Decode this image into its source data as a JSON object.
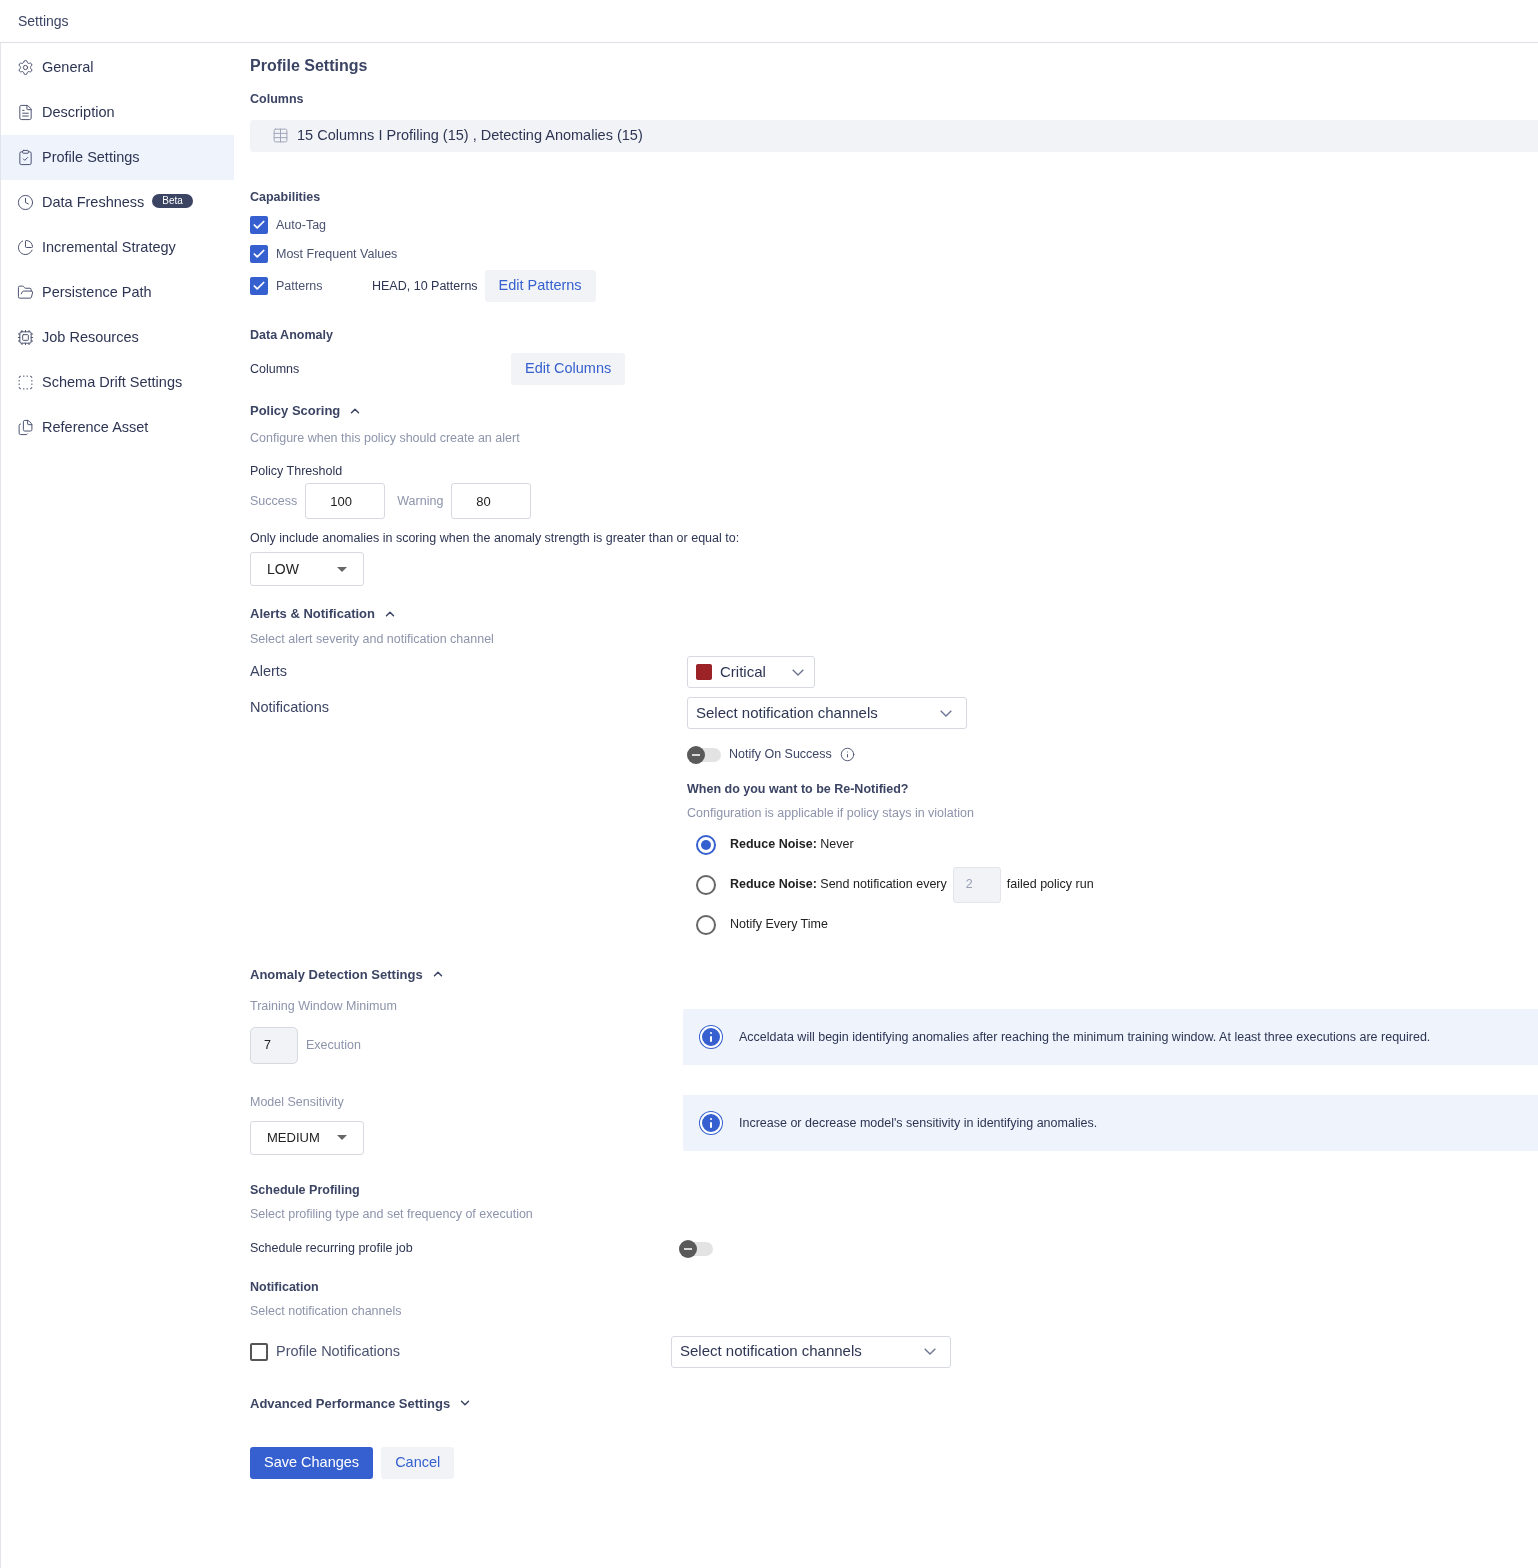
{
  "header": {
    "title": "Settings"
  },
  "sidebar": {
    "items": [
      {
        "label": "General",
        "selected": false
      },
      {
        "label": "Description",
        "selected": false
      },
      {
        "label": "Profile Settings",
        "selected": true
      },
      {
        "label": "Data Freshness",
        "selected": false,
        "badge": "Beta"
      },
      {
        "label": "Incremental Strategy",
        "selected": false
      },
      {
        "label": "Persistence Path",
        "selected": false
      },
      {
        "label": "Job Resources",
        "selected": false
      },
      {
        "label": "Schema Drift Settings",
        "selected": false
      },
      {
        "label": "Reference Asset",
        "selected": false
      }
    ]
  },
  "profile": {
    "title": "Profile Settings",
    "columns_label": "Columns",
    "columns_summary": "15 Columns I Profiling (15) , Detecting Anomalies (15)"
  },
  "capabilities": {
    "title": "Capabilities",
    "items": [
      {
        "label": "Auto-Tag",
        "checked": true
      },
      {
        "label": "Most Frequent Values",
        "checked": true
      },
      {
        "label": "Patterns",
        "checked": true,
        "detail": "HEAD, 10 Patterns",
        "button": "Edit Patterns"
      }
    ]
  },
  "data_anomaly": {
    "title": "Data Anomaly",
    "label": "Columns",
    "button": "Edit Columns"
  },
  "policy_scoring": {
    "title": "Policy Scoring",
    "expanded": true,
    "description": "Configure when this policy should create an alert",
    "threshold_label": "Policy Threshold",
    "fields": [
      {
        "label": "Success",
        "value": "100"
      },
      {
        "label": "Warning",
        "value": "80"
      }
    ],
    "strength_note": "Only include anomalies in scoring when the anomaly strength is greater than or equal to:",
    "strength_value": "LOW"
  },
  "alerts": {
    "title": "Alerts & Notification",
    "expanded": true,
    "description": "Select alert severity and notification channel",
    "alerts_label": "Alerts",
    "severity": {
      "value": "Critical",
      "color": "#9b2226"
    },
    "notifications_label": "Notifications",
    "channels_placeholder": "Select notification channels",
    "notify_on_success": {
      "label": "Notify On Success",
      "on": false
    },
    "renotify": {
      "title": "When do you want to be Re-Notified?",
      "description": "Configuration is applicable if policy stays in violation",
      "options": [
        {
          "label": "**Reduce Noise:** Never",
          "selected": true
        },
        {
          "label": "**Reduce Noise:** Send notification every",
          "selected": false,
          "count": "2",
          "suffix": "failed policy run"
        },
        {
          "label": "Notify Every Time",
          "selected": false
        }
      ]
    }
  },
  "anomaly": {
    "title": "Anomaly Detection Settings",
    "expanded": true,
    "training_label": "Training Window Minimum",
    "training_value": "7",
    "training_unit": "Execution",
    "training_info": "Acceldata will begin identifying anomalies after reaching the minimum training window. At least three executions are required.",
    "sensitivity_label": "Model Sensitivity",
    "sensitivity_value": "MEDIUM",
    "sensitivity_info": "Increase or decrease model's sensitivity in identifying anomalies."
  },
  "schedule": {
    "title": "Schedule Profiling",
    "description": "Select profiling type and set frequency of execution",
    "recurring_label": "Schedule recurring profile job",
    "recurring_on": false
  },
  "notification": {
    "title": "Notification",
    "description": "Select notification channels",
    "checkbox": {
      "label": "Profile Notifications",
      "checked": false
    },
    "channels_placeholder": "Select notification channels"
  },
  "advanced": {
    "title": "Advanced Performance Settings",
    "expanded": false
  },
  "actions": [
    {
      "kind": "primary",
      "label": "Save Changes"
    },
    {
      "kind": "secondary",
      "label": "Cancel"
    }
  ]
}
